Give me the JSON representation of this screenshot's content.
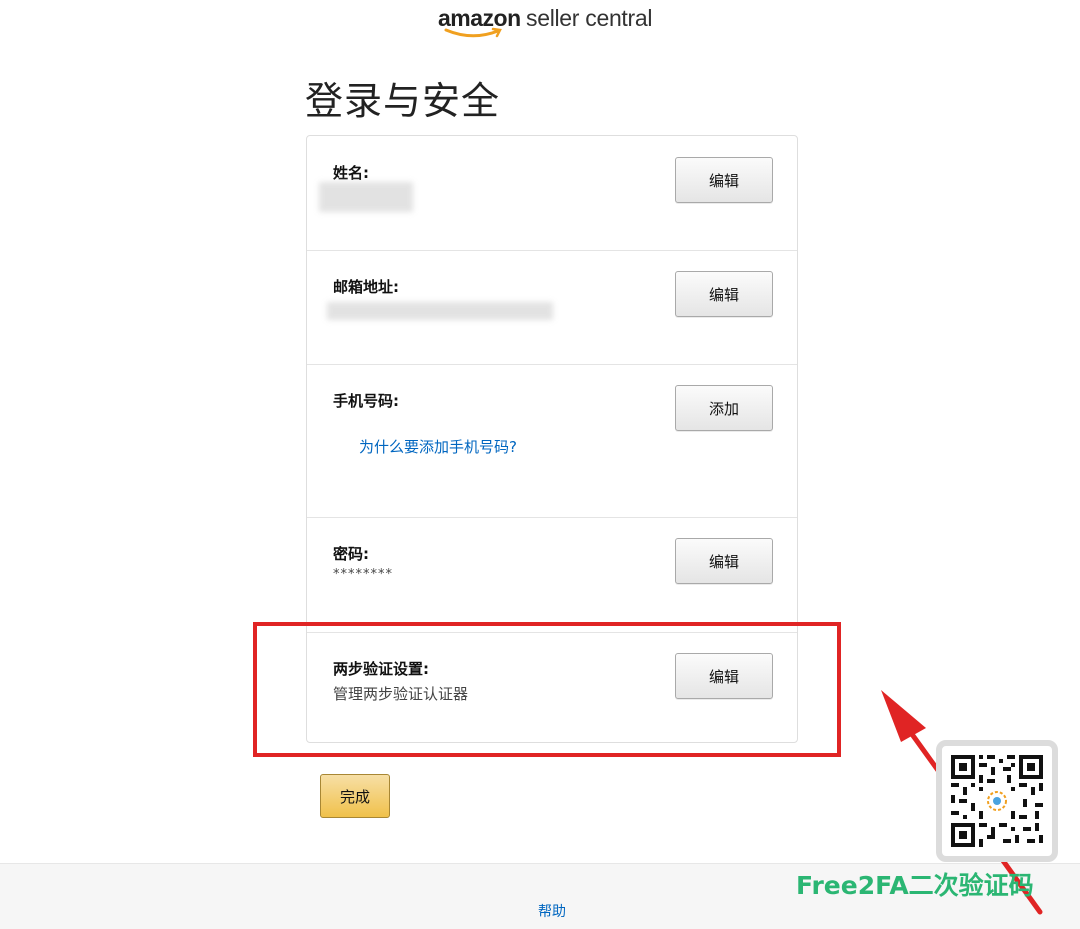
{
  "header": {
    "logo_brand": "amazon",
    "logo_product": "seller central",
    "page_title": "登录与安全"
  },
  "rows": {
    "name": {
      "label": "姓名:",
      "button": "编辑"
    },
    "email": {
      "label": "邮箱地址:",
      "button": "编辑"
    },
    "phone": {
      "label": "手机号码:",
      "button": "添加",
      "link": "为什么要添加手机号码?"
    },
    "password": {
      "label": "密码:",
      "mask": "********",
      "button": "编辑"
    },
    "two_step": {
      "label": "两步验证设置:",
      "sub": "管理两步验证认证器",
      "button": "编辑"
    }
  },
  "actions": {
    "done": "完成"
  },
  "footer": {
    "help": "帮助"
  },
  "overlay": {
    "watermark": "Free2FA二次验证码",
    "highlight_color": "#e02424",
    "watermark_color": "#2bb673"
  },
  "colors": {
    "link": "#0066c0",
    "primary_button": "#f0c14b"
  },
  "icons": {
    "logo_smile": "amazon-smile-icon",
    "qr": "qr-code-icon",
    "arrow": "red-arrow-icon"
  }
}
